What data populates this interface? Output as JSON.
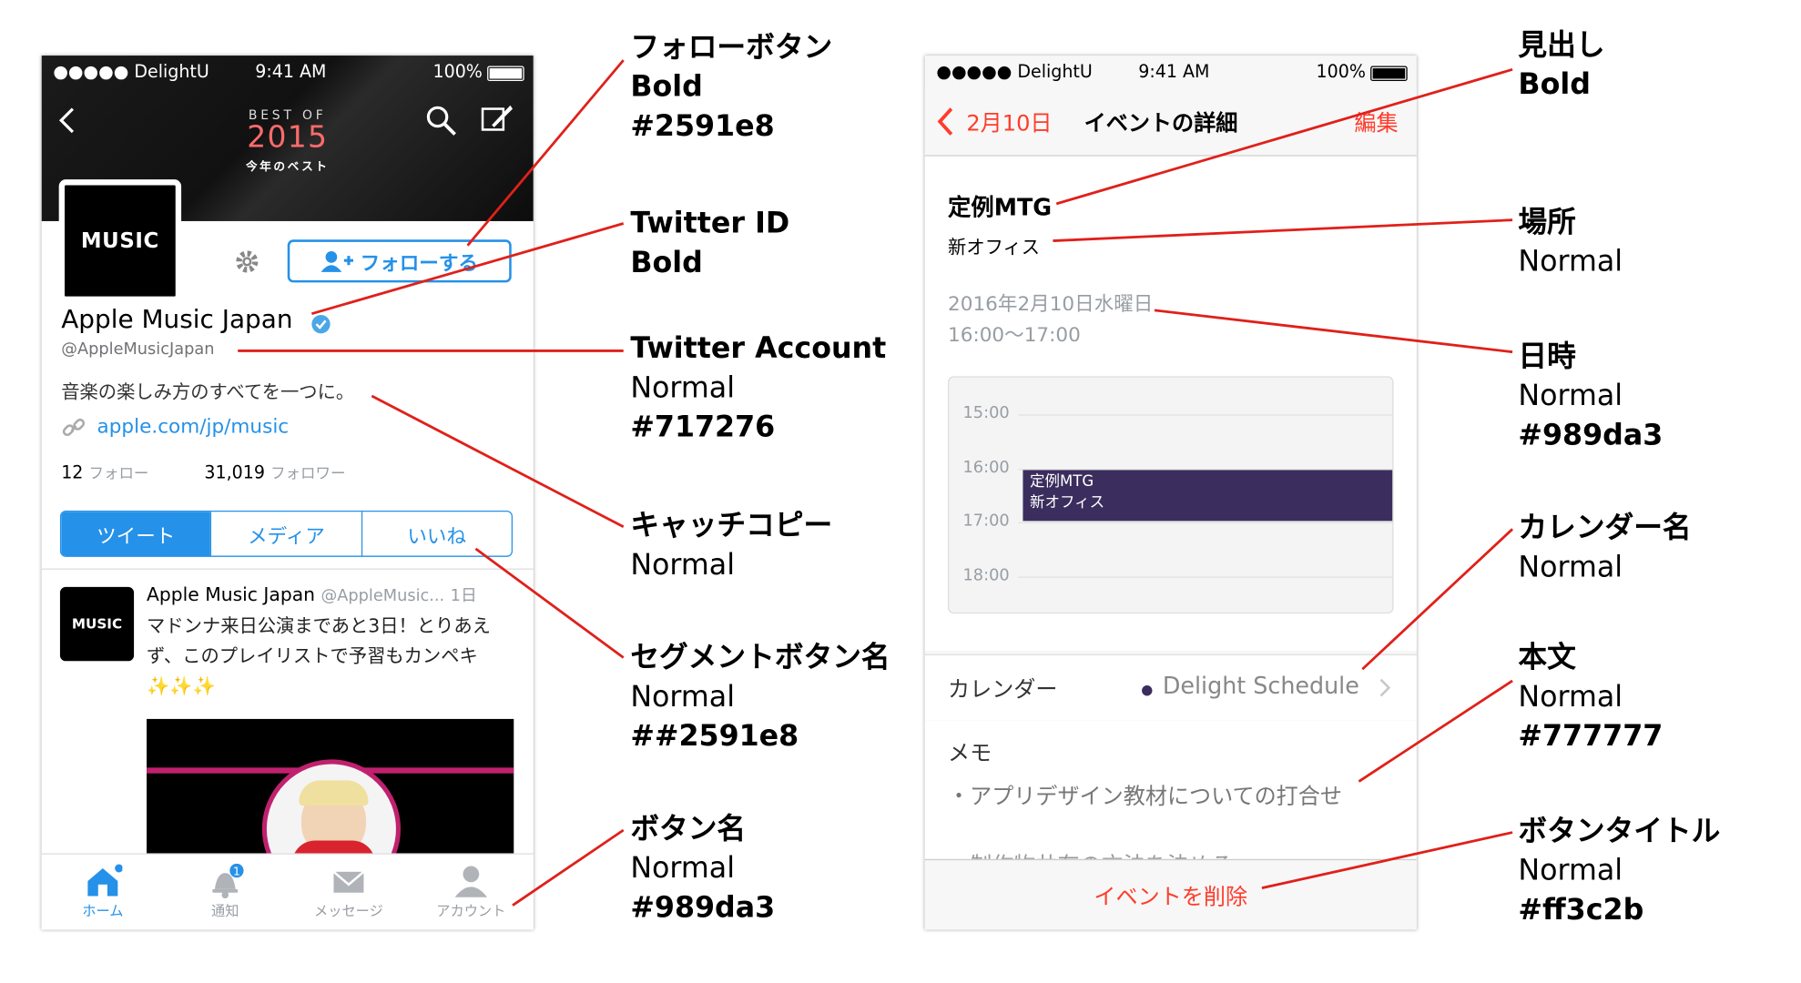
{
  "phone1": {
    "status": {
      "carrier": "●●●●● DelightU",
      "time": "9:41 AM",
      "battery": "100%"
    },
    "header": {
      "best_of": "BEST OF",
      "year": "2015",
      "subtitle": "今年のベスト"
    },
    "avatar_text": " MUSIC",
    "follow_button": "フォローする",
    "name": "Apple Music Japan",
    "handle": "@AppleMusicJapan",
    "bio": "音楽の楽しみ方のすべてを一つに。",
    "link": "apple.com/jp/music",
    "following_count": "12",
    "following_label": "フォロー",
    "followers_count": "31,019",
    "followers_label": "フォロワー",
    "segments": [
      "ツイート",
      "メディア",
      "いいね"
    ],
    "tweet": {
      "name": "Apple Music Japan",
      "handle": "@AppleMusic...",
      "time": "1日",
      "text": "マドンナ来日公演まであと3日！とりあえず、このプレイリストで予習もカンペキ✨✨✨"
    },
    "tabs": [
      "ホーム",
      "通知",
      "メッセージ",
      "アカウント"
    ],
    "badge": "1"
  },
  "phone2": {
    "status": {
      "carrier": "●●●●● DelightU",
      "time": "9:41 AM",
      "battery": "100%"
    },
    "nav": {
      "back": "2月10日",
      "title": "イベントの詳細",
      "edit": "編集"
    },
    "event_title": "定例MTG",
    "location": "新オフィス",
    "date": "2016年2月10日水曜日",
    "time_range": "16:00〜17:00",
    "hours": [
      "15:00",
      "16:00",
      "17:00",
      "18:00"
    ],
    "block": {
      "title": "定例MTG",
      "location": "新オフィス"
    },
    "calendar_label": "カレンダー",
    "calendar_name": "Delight Schedule",
    "memo_label": "メモ",
    "memo_text": "・アプリデザイン教材についての打合せ",
    "memo_cut": "・制作物共有の方法を決める",
    "delete": "イベントを削除"
  },
  "annotations_left": [
    {
      "title": "フォローボタン",
      "lines": [
        "Bold",
        "#2591e8"
      ]
    },
    {
      "title": "Twitter ID",
      "lines": [
        "Bold"
      ]
    },
    {
      "title": "Twitter Account",
      "lines": [
        "Normal",
        "#717276"
      ]
    },
    {
      "title": "キャッチコピー",
      "lines": [
        "Normal"
      ]
    },
    {
      "title": "セグメントボタン名",
      "lines": [
        "Normal",
        "##2591e8"
      ]
    },
    {
      "title": "ボタン名",
      "lines": [
        "Normal",
        "#989da3"
      ]
    }
  ],
  "annotations_right": [
    {
      "title": "見出し",
      "lines": [
        "Bold"
      ]
    },
    {
      "title": "場所",
      "lines": [
        "Normal"
      ]
    },
    {
      "title": "日時",
      "lines": [
        "Normal",
        "#989da3"
      ]
    },
    {
      "title": "カレンダー名",
      "lines": [
        "Normal"
      ]
    },
    {
      "title": "本文",
      "lines": [
        "Normal",
        "#777777"
      ]
    },
    {
      "title": "ボタンタイトル",
      "lines": [
        "Normal",
        "#ff3c2b"
      ]
    }
  ],
  "colors": {
    "blue": "#2591e8",
    "gray": "#717276",
    "lightgray": "#989da3",
    "body": "#777777",
    "red": "#ff3c2b",
    "purple": "#3b2e5e",
    "line": "#e0201a"
  }
}
